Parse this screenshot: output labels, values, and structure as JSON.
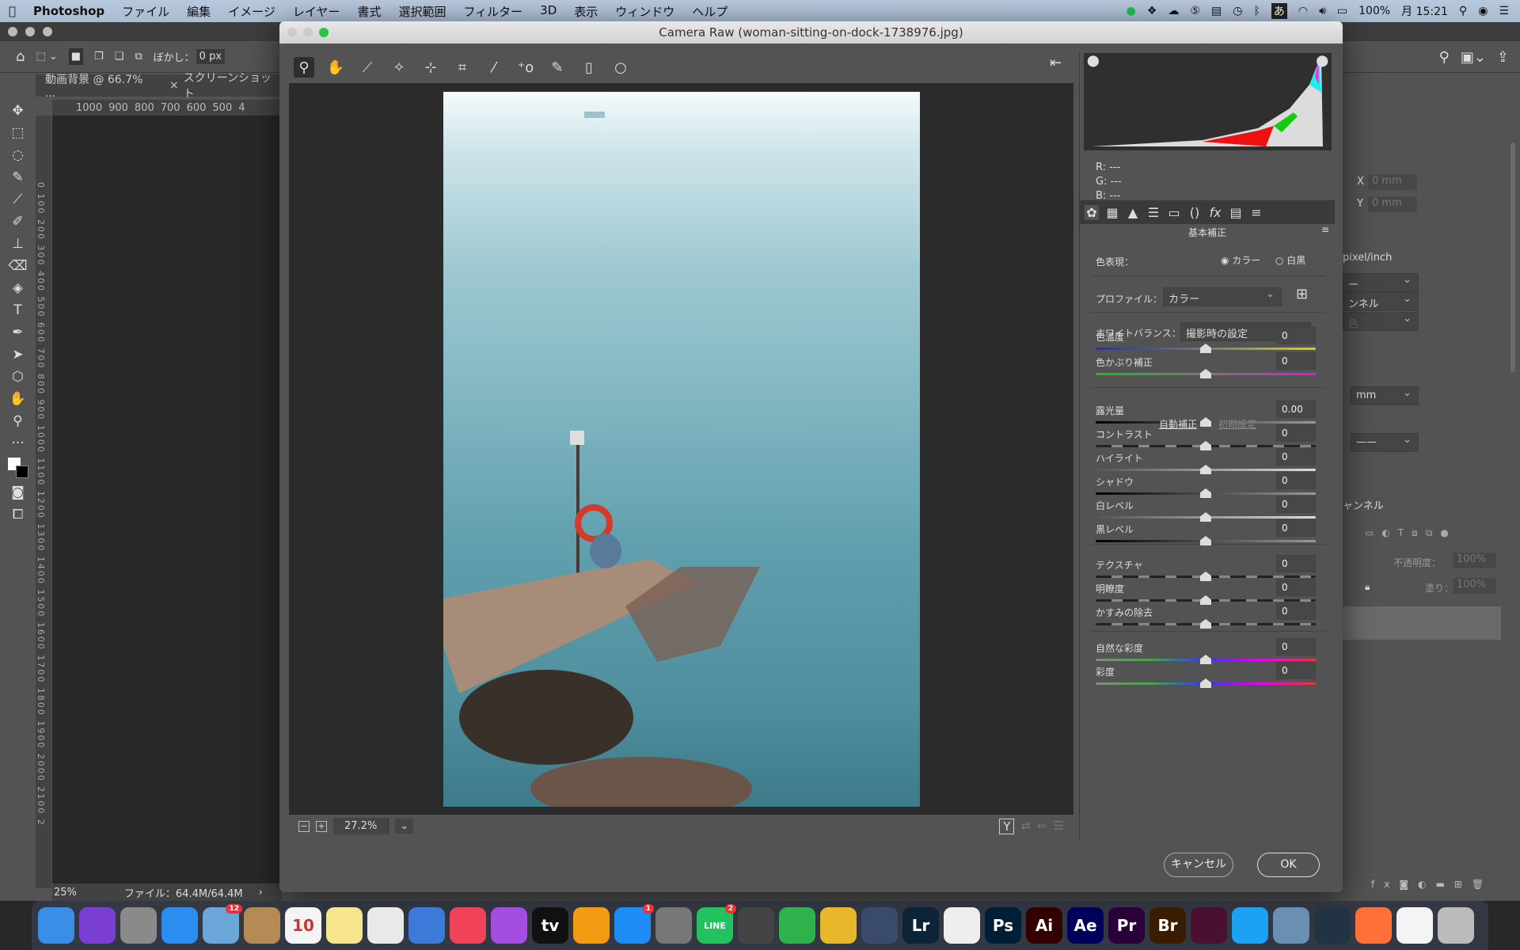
{
  "menubar": {
    "app": "Photoshop",
    "items": [
      "ファイル",
      "編集",
      "イメージ",
      "レイヤー",
      "書式",
      "選択範囲",
      "フィルター",
      "3D",
      "表示",
      "ウィンドウ",
      "ヘルプ"
    ],
    "battery": "100%",
    "clock": "月 15:21",
    "status_icons": [
      "line-icon",
      "dropbox-icon",
      "creative-cloud-icon",
      "html5-icon",
      "wallet-icon",
      "time-machine-icon",
      "bluetooth-icon",
      "input-method-icon",
      "wifi-icon",
      "volume-icon",
      "battery-icon",
      "search-icon",
      "siri-icon",
      "list-icon"
    ],
    "ime": "あ"
  },
  "ps": {
    "feather_label": "ぼかし：",
    "feather_value": "0 px",
    "tabs": [
      "動画背景 @ 66.7% ...",
      "スクリーンショット"
    ],
    "ruler_h": [
      "1000",
      "900",
      "800",
      "700",
      "600",
      "500",
      "4"
    ],
    "ruler_v": "0 100 200 300 400 500 600 700 800 900 1000 1100 1200 1300 1400 1500 1600 1700 1800 1900 2000 2100 2",
    "zoom": "25%",
    "file_info": "ファイル：64.4M/64.4M",
    "props": {
      "x_label": "X",
      "x_value": "0 mm",
      "y_label": "Y",
      "y_value": "0 mm",
      "resolution": "pixel/inch",
      "sel1": "ー",
      "sel2": "ンネル",
      "sel3": "色",
      "unit": "mm",
      "channels_tab": "ャンネル",
      "opacity_label": "不透明度：",
      "opacity": "100%",
      "fill_label": "塗り：",
      "fill": "100%"
    }
  },
  "cr": {
    "title": "Camera Raw (woman-sitting-on-dock-1738976.jpg)",
    "tools": [
      "zoom-tool-icon",
      "hand-tool-icon",
      "white-balance-tool-icon",
      "color-sampler-tool-icon",
      "targeted-adjustment-tool-icon",
      "transform-tool-icon",
      "spot-removal-tool-icon",
      "red-eye-tool-icon",
      "adjustment-brush-icon",
      "graduated-filter-icon",
      "radial-filter-icon"
    ],
    "zoom": "27.2%",
    "rgb": {
      "r_label": "R:",
      "r": "---",
      "g_label": "G:",
      "g": "---",
      "b_label": "B:",
      "b": "---"
    },
    "panel_title": "基本補正",
    "treatment_label": "色表現：",
    "treatment_options": [
      "カラー",
      "白黒"
    ],
    "treatment_selected": "カラー",
    "profile_label": "プロファイル：",
    "profile_value": "カラー",
    "wb_label": "ホワイトバランス：",
    "wb_value": "撮影時の設定",
    "auto": "自動補正",
    "default": "初期設定",
    "sliders": [
      {
        "label": "色温度",
        "value": "0",
        "track": "temp"
      },
      {
        "label": "色かぶり補正",
        "value": "0",
        "track": "tint"
      },
      {
        "label": "露光量",
        "value": "0.00",
        "track": "dark"
      },
      {
        "label": "コントラスト",
        "value": "0",
        "track": "dash"
      },
      {
        "label": "ハイライト",
        "value": "0",
        "track": "light"
      },
      {
        "label": "シャドウ",
        "value": "0",
        "track": "dark"
      },
      {
        "label": "白レベル",
        "value": "0",
        "track": "light"
      },
      {
        "label": "黒レベル",
        "value": "0",
        "track": "dark"
      },
      {
        "label": "テクスチャ",
        "value": "0",
        "track": "dash"
      },
      {
        "label": "明瞭度",
        "value": "0",
        "track": "dash"
      },
      {
        "label": "かすみの除去",
        "value": "0",
        "track": "dash"
      },
      {
        "label": "自然な彩度",
        "value": "0",
        "track": "hue"
      },
      {
        "label": "彩度",
        "value": "0",
        "track": "hue"
      }
    ],
    "cancel": "キャンセル",
    "ok": "OK"
  },
  "dock": [
    {
      "name": "finder",
      "color": "#3a8ee6"
    },
    {
      "name": "siri",
      "color": "#7a3fd1"
    },
    {
      "name": "launchpad",
      "color": "#8a8a8a"
    },
    {
      "name": "safari",
      "color": "#2d8cf0"
    },
    {
      "name": "mail",
      "color": "#6aa7d8",
      "badge": "12"
    },
    {
      "name": "contacts",
      "color": "#b58a55"
    },
    {
      "name": "calendar",
      "color": "#f4f4f4",
      "text": "10"
    },
    {
      "name": "notes",
      "color": "#f6e58d"
    },
    {
      "name": "textedit",
      "color": "#e9e9e9"
    },
    {
      "name": "keynote",
      "color": "#3b7ad8"
    },
    {
      "name": "music",
      "color": "#f0435a"
    },
    {
      "name": "podcasts",
      "color": "#a54de0"
    },
    {
      "name": "apple-tv",
      "color": "#111",
      "text": "tv"
    },
    {
      "name": "books",
      "color": "#f39c12"
    },
    {
      "name": "app-store",
      "color": "#1d8cf5",
      "badge": "1"
    },
    {
      "name": "system-preferences",
      "color": "#777"
    },
    {
      "name": "line",
      "color": "#22c35e",
      "badge": "2",
      "text": "LINE"
    },
    {
      "name": "quicktime",
      "color": "#444"
    },
    {
      "name": "numbers",
      "color": "#2fb24c"
    },
    {
      "name": "chrome",
      "color": "#e9b82a"
    },
    {
      "name": "bull-app",
      "color": "#3a4a6a"
    },
    {
      "name": "lightroom",
      "color": "#0d2436",
      "text": "Lr"
    },
    {
      "name": "text-file",
      "color": "#eee"
    },
    {
      "name": "photoshop",
      "color": "#001e36",
      "text": "Ps"
    },
    {
      "name": "illustrator",
      "color": "#330000",
      "text": "Ai"
    },
    {
      "name": "after-effects",
      "color": "#00005b",
      "text": "Ae"
    },
    {
      "name": "premiere",
      "color": "#2a0038",
      "text": "Pr"
    },
    {
      "name": "bridge",
      "color": "#3a1d00",
      "text": "Br"
    },
    {
      "name": "rewards",
      "color": "#4a1030"
    },
    {
      "name": "twitter",
      "color": "#1da1f2"
    },
    {
      "name": "preview",
      "color": "#6b8fb3"
    },
    {
      "name": "stack-app",
      "color": "#234"
    },
    {
      "name": "firefox",
      "color": "#ff7139"
    },
    {
      "name": "document",
      "color": "#f4f4f4"
    },
    {
      "name": "trash",
      "color": "#bbb"
    }
  ]
}
